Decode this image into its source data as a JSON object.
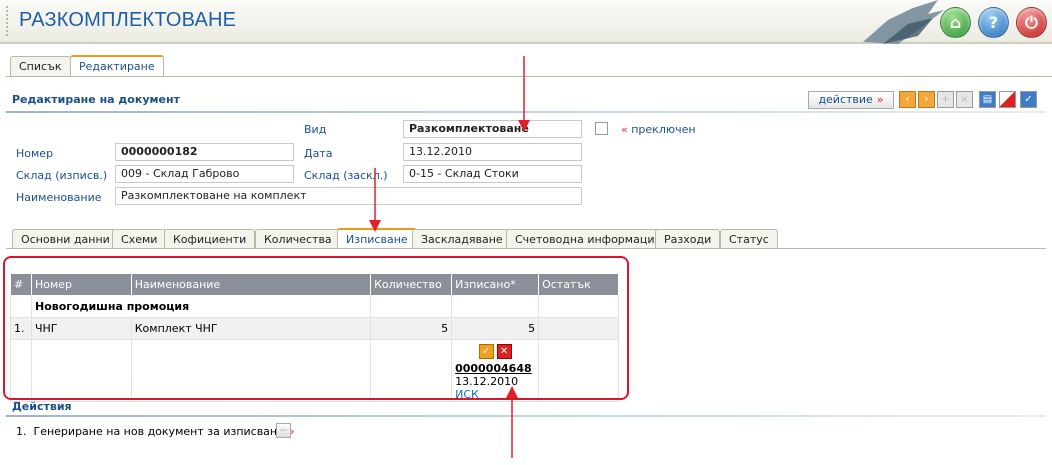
{
  "header": {
    "title": "РАЗКОМПЛЕКТОВАНЕ"
  },
  "top_tabs": [
    {
      "label": "Списък"
    },
    {
      "label": "Редактиране"
    }
  ],
  "section": {
    "title": "Редактиране на документ",
    "action_label": "действие",
    "action_arrow": "»"
  },
  "toolbar": {
    "icons": [
      "prev-icon",
      "next-icon",
      "add-icon",
      "delete-icon",
      "print-icon",
      "flag-icon",
      "confirm-icon"
    ]
  },
  "form": {
    "vid_label": "Вид",
    "vid_value": "Разкомплектоване",
    "switched_prefix": "«",
    "switched_label": "преключен",
    "nomer_label": "Номер",
    "nomer_value": "0000000182",
    "data_label": "Дата",
    "data_value": "13.12.2010",
    "sklad_out_label": "Склад (изписв.)",
    "sklad_out_value": "009 - Склад Габрово",
    "sklad_in_label": "Склад (заскл.)",
    "sklad_in_value": "0-15 - Склад Стоки",
    "name_label": "Наименование",
    "name_value": "Разкомплектоване на комплект"
  },
  "inner_tabs": [
    {
      "label": "Основни данни"
    },
    {
      "label": "Схеми"
    },
    {
      "label": "Кофициенти"
    },
    {
      "label": "Количества"
    },
    {
      "label": "Изписване"
    },
    {
      "label": "Заскладяване"
    },
    {
      "label": "Счетоводна информация"
    },
    {
      "label": "Разходи"
    },
    {
      "label": "Статус"
    }
  ],
  "table": {
    "headers": [
      "#",
      "Номер",
      "Наименование",
      "Количество",
      "Изписано*",
      "Остатък"
    ],
    "group": "Новогодишна промоция",
    "rows": [
      {
        "idx": "1.",
        "nomer": "ЧНГ",
        "name": "Комплект ЧНГ",
        "qty": "5",
        "written": "5",
        "rest": ""
      }
    ],
    "doc": {
      "number": "0000004648",
      "date": "13.12.2010",
      "type": "ИСК"
    }
  },
  "actions": {
    "title": "Действия",
    "items": [
      {
        "idx": "1.",
        "label": "Генериране на нов документ за изписване",
        "arrow": "»"
      }
    ]
  },
  "colors": {
    "accent": "#1a4f8c",
    "tab_active": "#e99a16",
    "annotation": "#d8182a"
  }
}
